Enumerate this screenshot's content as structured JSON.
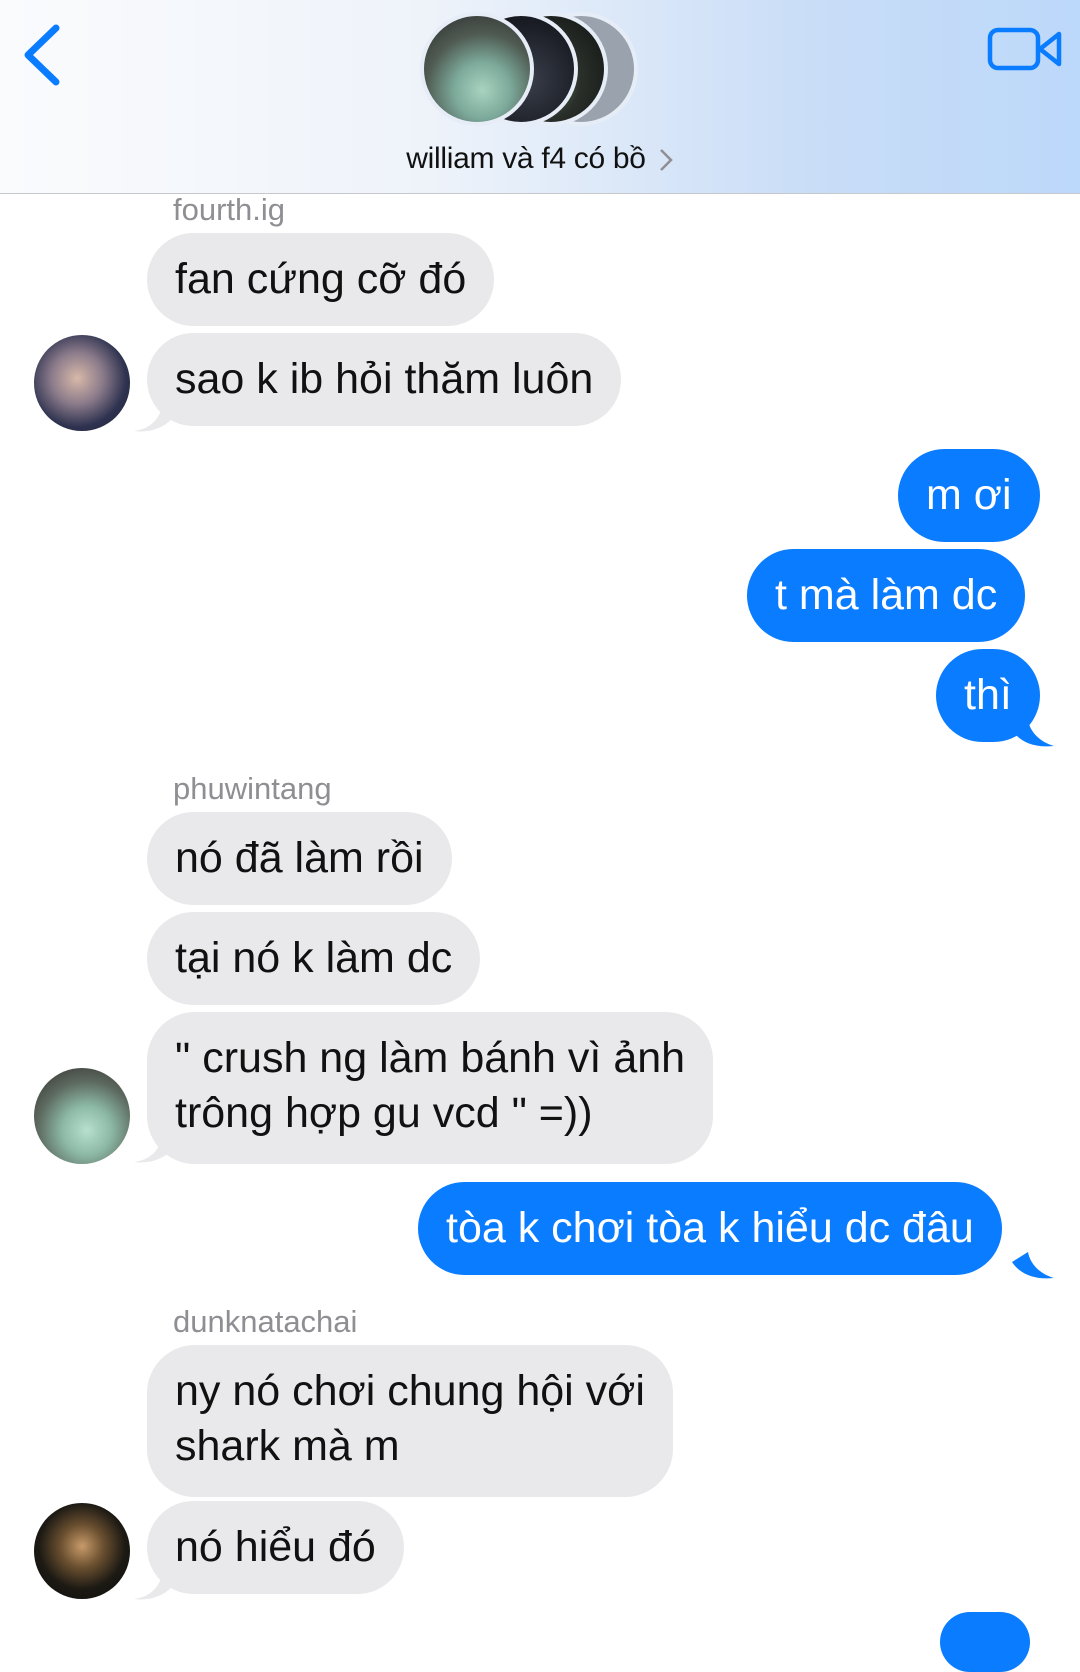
{
  "header": {
    "title": "william và f4 có bồ",
    "back_icon": "chevron-left-icon",
    "video_icon": "video-camera-icon",
    "accent_color": "#0a7cff"
  },
  "messages": [
    {
      "type": "name",
      "text": "fourth.ig"
    },
    {
      "type": "in",
      "text": "fan cứng cỡ đó"
    },
    {
      "type": "in",
      "text": "sao k ib hỏi thăm luôn"
    },
    {
      "type": "out",
      "text": "m ơi"
    },
    {
      "type": "out",
      "text": "t mà làm dc"
    },
    {
      "type": "out",
      "text": "thì"
    },
    {
      "type": "name",
      "text": "phuwintang"
    },
    {
      "type": "in",
      "text": "nó đã làm rồi"
    },
    {
      "type": "in",
      "text": "tại nó k làm dc"
    },
    {
      "type": "in",
      "line1": "\" crush ng làm bánh vì ảnh",
      "line2": "trông hợp gu vcd \" =))"
    },
    {
      "type": "out",
      "text": "tòa k chơi tòa k hiểu dc đâu"
    },
    {
      "type": "name",
      "text": "dunknatachai"
    },
    {
      "type": "in",
      "line1": "ny nó chơi chung hội với",
      "line2": "shark mà m"
    },
    {
      "type": "in",
      "text": "nó hiểu đó"
    }
  ],
  "colors": {
    "incoming_bubble": "#e9e9eb",
    "outgoing_bubble": "#0a7cff",
    "sender_name": "#8e8e93"
  }
}
